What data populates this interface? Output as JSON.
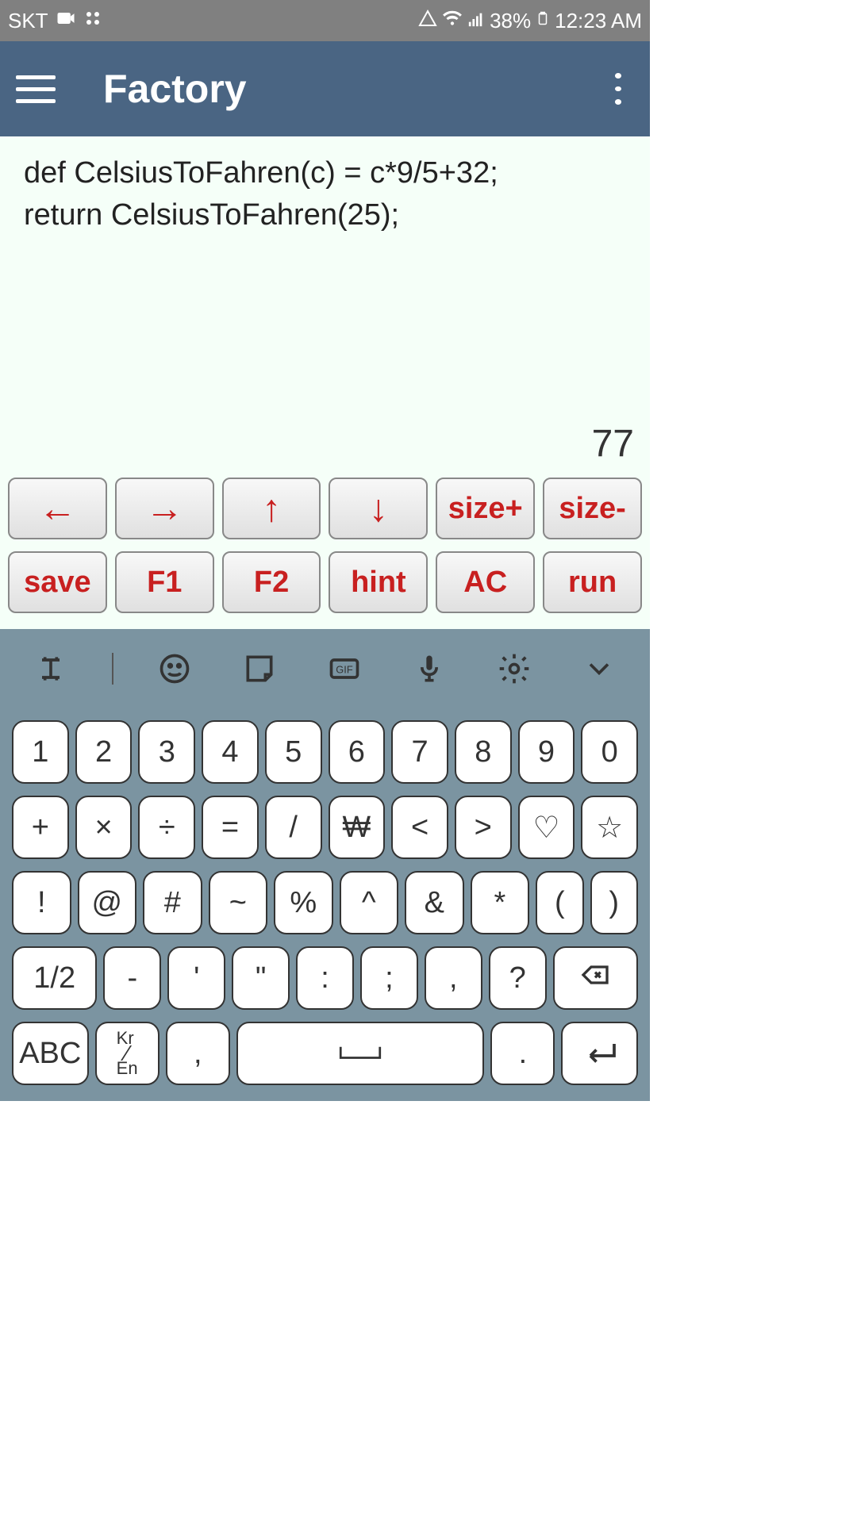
{
  "status_bar": {
    "carrier": "SKT",
    "battery": "38%",
    "time": "12:23 AM"
  },
  "app_bar": {
    "title": "Factory"
  },
  "editor": {
    "code_line1": "def CelsiusToFahren(c) = c*9/5+32;",
    "code_line2": "",
    "code_line3": "return CelsiusToFahren(25);",
    "result": "77"
  },
  "fn_buttons": {
    "row1": [
      "←",
      "→",
      "↑",
      "↓",
      "size+",
      "size-"
    ],
    "row2": [
      "save",
      "F1",
      "F2",
      "hint",
      "AC",
      "run"
    ]
  },
  "keyboard": {
    "row1": [
      "1",
      "2",
      "3",
      "4",
      "5",
      "6",
      "7",
      "8",
      "9",
      "0"
    ],
    "row2": [
      "+",
      "×",
      "÷",
      "=",
      "/",
      "₩",
      "<",
      ">",
      "♡",
      "☆"
    ],
    "row3": [
      "!",
      "@",
      "#",
      "~",
      "%",
      "^",
      "&",
      "*",
      "(",
      ")"
    ],
    "row4_mode": "1/2",
    "row4": [
      "-",
      "'",
      "\"",
      ":",
      ";",
      ",",
      "?"
    ],
    "row5_abc": "ABC",
    "row5_lang": "Kr/En",
    "row5_comma": ",",
    "row5_period": "."
  }
}
